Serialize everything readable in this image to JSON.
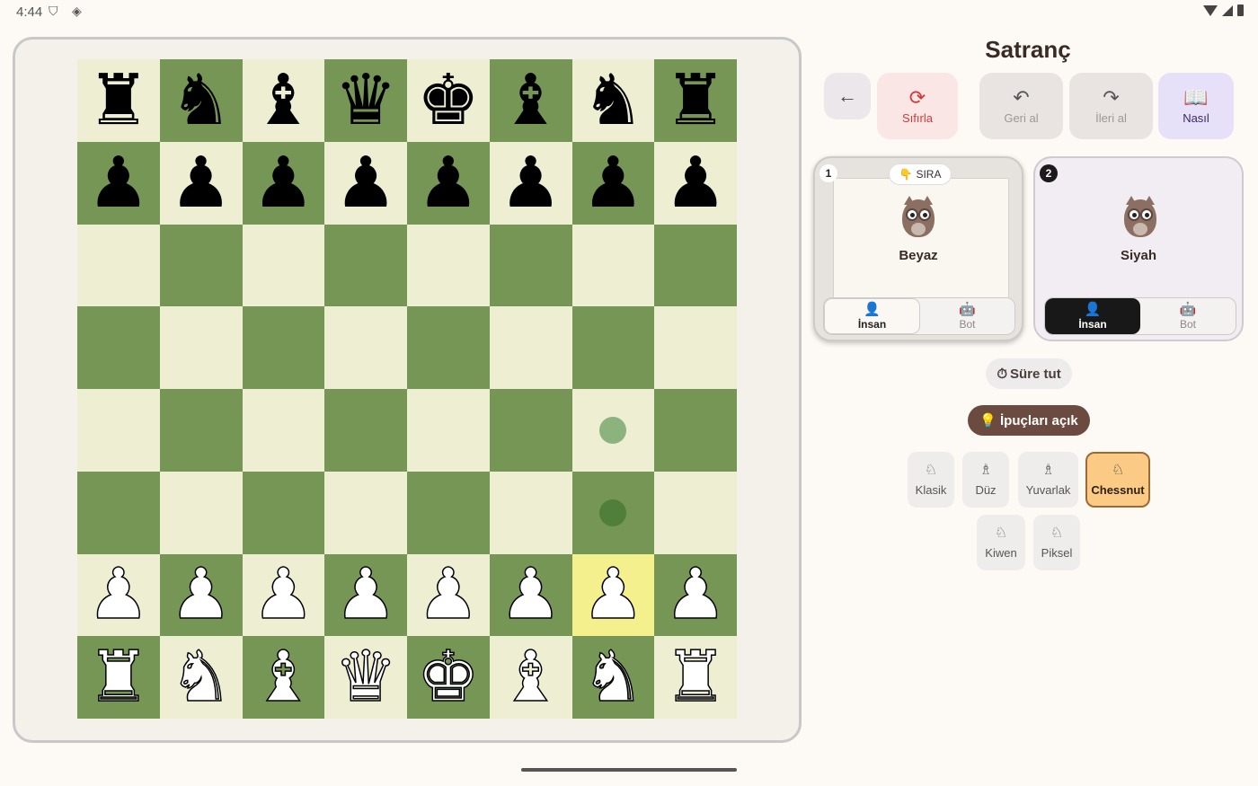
{
  "status_bar": {
    "time": "4:44",
    "left_icons": [
      "shield-icon",
      "cast-icon"
    ],
    "right_icons": [
      "wifi-icon",
      "signal-icon",
      "battery-icon"
    ]
  },
  "board": {
    "light_color": "#eeeed2",
    "dark_color": "#769656",
    "highlight_color": "#f5f08e",
    "highlighted_square": "g2",
    "move_hints": [
      "g3",
      "g4"
    ],
    "position": [
      [
        "r",
        "n",
        "b",
        "q",
        "k",
        "b",
        "n",
        "r"
      ],
      [
        "p",
        "p",
        "p",
        "p",
        "p",
        "p",
        "p",
        "p"
      ],
      [
        "",
        "",
        "",
        "",
        "",
        "",
        "",
        ""
      ],
      [
        "",
        "",
        "",
        "",
        "",
        "",
        "",
        ""
      ],
      [
        "",
        "",
        "",
        "",
        "",
        "",
        "",
        ""
      ],
      [
        "",
        "",
        "",
        "",
        "",
        "",
        "",
        ""
      ],
      [
        "P",
        "P",
        "P",
        "P",
        "P",
        "P",
        "P",
        "P"
      ],
      [
        "R",
        "N",
        "B",
        "Q",
        "K",
        "B",
        "N",
        "R"
      ]
    ]
  },
  "header": {
    "title": "Satranç"
  },
  "toolbar": {
    "back_icon": "←",
    "reset_label": "Sıfırla",
    "reset_icon": "⟳",
    "undo_label": "Geri al",
    "undo_icon": "↶",
    "redo_label": "İleri al",
    "redo_icon": "↷",
    "how_label": "Nasıl",
    "how_icon": "📖"
  },
  "players": [
    {
      "number": "1",
      "name": "Beyaz",
      "turn_badge": "SIRA",
      "turn_icon": "👇",
      "modes": [
        {
          "label": "İnsan",
          "icon": "👤"
        },
        {
          "label": "Bot",
          "icon": "🤖"
        }
      ],
      "selected_mode": "İnsan"
    },
    {
      "number": "2",
      "name": "Siyah",
      "modes": [
        {
          "label": "İnsan",
          "icon": "👤"
        },
        {
          "label": "Bot",
          "icon": "🤖"
        }
      ],
      "selected_mode": "İnsan"
    }
  ],
  "timer": {
    "icon": "⏱",
    "label": "Süre tut"
  },
  "hints": {
    "icon": "💡",
    "label": "İpuçları açık"
  },
  "themes": [
    {
      "label": "Klasik",
      "icon": "♘"
    },
    {
      "label": "Düz",
      "icon": "♗"
    },
    {
      "label": "Yuvarlak",
      "icon": "♗"
    },
    {
      "label": "Chessnut",
      "icon": "♘",
      "selected": true
    },
    {
      "label": "Kiwen",
      "icon": "♘"
    },
    {
      "label": "Piksel",
      "icon": "♘"
    }
  ]
}
